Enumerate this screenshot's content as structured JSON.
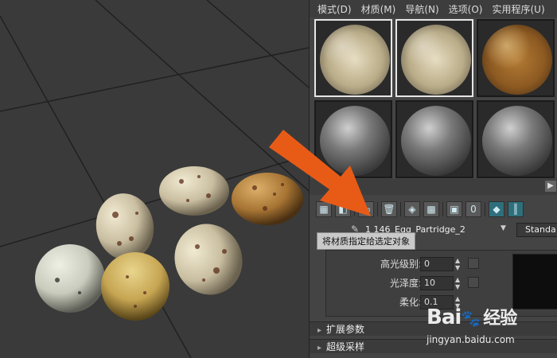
{
  "menubar": {
    "items": [
      "模式(D)",
      "材质(M)",
      "导航(N)",
      "选项(O)",
      "实用程序(U)"
    ]
  },
  "material": {
    "name": "1 146_Egg_Partridge_2",
    "type": "Standa"
  },
  "tooltip": "将材质指定给选定对象",
  "params": {
    "highlight_level_label": "高光级别:",
    "highlight_level_value": "0",
    "glossiness_label": "光泽度:",
    "glossiness_value": "10",
    "soften_label": "柔化:",
    "soften_value": "0.1"
  },
  "rollouts": {
    "extended": "扩展参数",
    "supersampling": "超级采样"
  },
  "watermark": {
    "logo": "Bai",
    "logo2": "经验",
    "url": "jingyan.baidu.com"
  },
  "colors": {
    "arrow": "#e85b17",
    "accent": "#2e6f7b"
  },
  "icons": {
    "arrow": "arrow-pointer-icon",
    "eyedropper": "eyedropper-icon",
    "dropdown": "chevron-down-icon"
  }
}
